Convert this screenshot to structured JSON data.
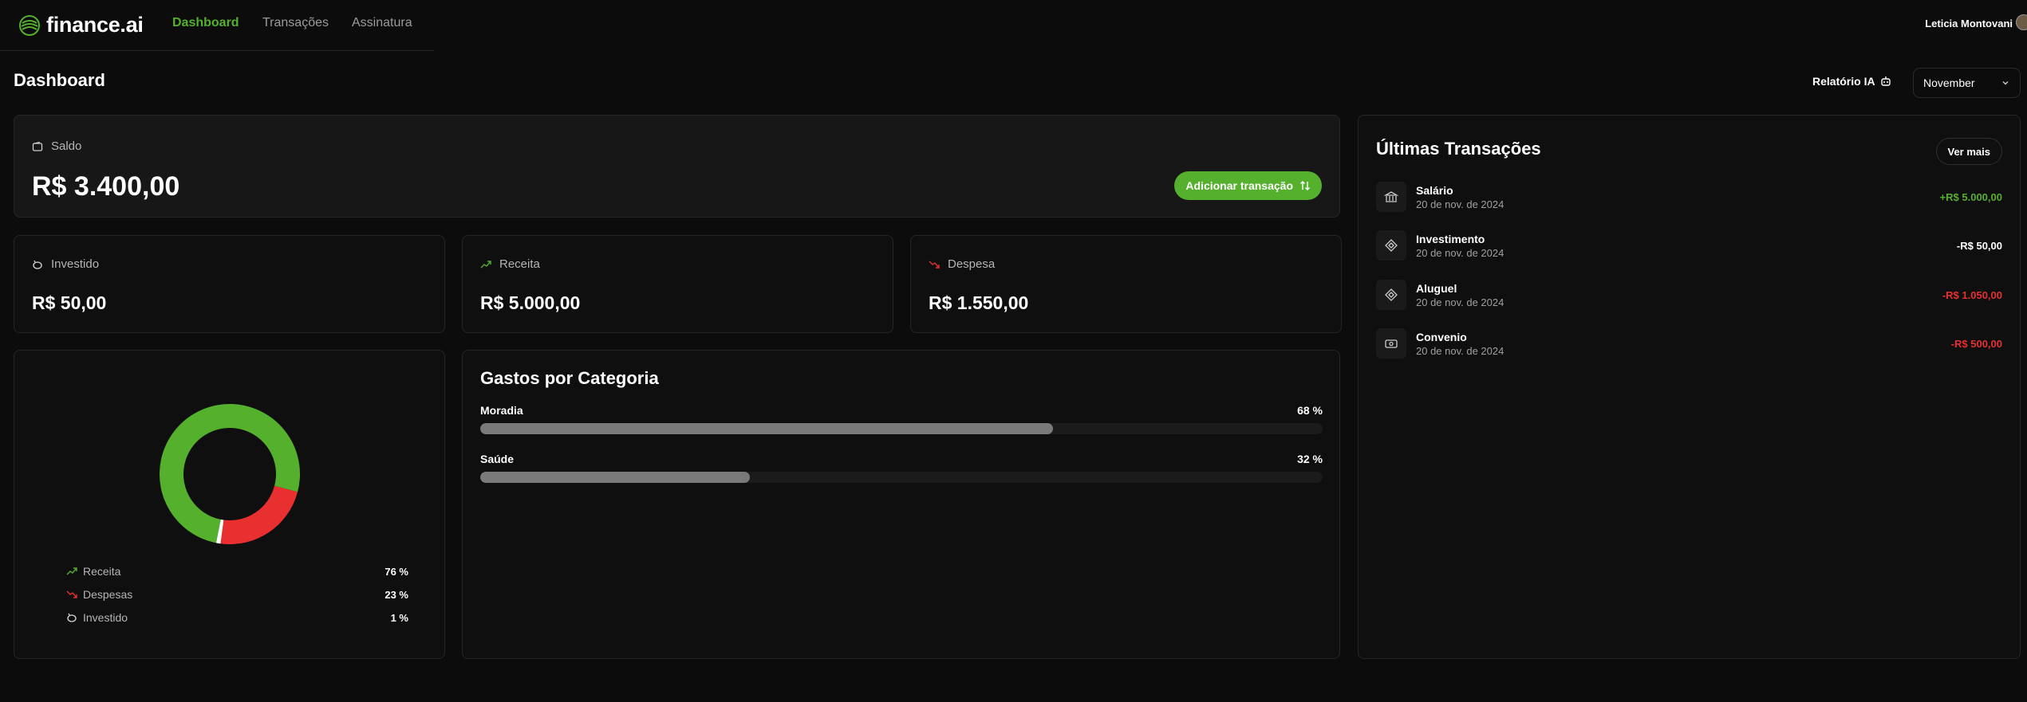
{
  "brand": {
    "name": "finance.ai"
  },
  "nav": [
    {
      "label": "Dashboard",
      "active": true
    },
    {
      "label": "Transações",
      "active": false
    },
    {
      "label": "Assinatura",
      "active": false
    }
  ],
  "user": {
    "name": "Leticia Montovani"
  },
  "page": {
    "title": "Dashboard"
  },
  "toolbar": {
    "report_label": "Relatório IA",
    "month": "November"
  },
  "saldo": {
    "label": "Saldo",
    "value": "R$ 3.400,00",
    "add_label": "Adicionar transação"
  },
  "summary": [
    {
      "label": "Investido",
      "value": "R$ 50,00",
      "icon": "piggy-bank-icon"
    },
    {
      "label": "Receita",
      "value": "R$ 5.000,00",
      "icon": "trending-up-icon"
    },
    {
      "label": "Despesa",
      "value": "R$ 1.550,00",
      "icon": "trending-down-icon"
    }
  ],
  "chart_data": {
    "type": "pie",
    "donut": true,
    "categories": [
      "Receita",
      "Despesas",
      "Investido"
    ],
    "values": [
      76,
      23,
      1
    ],
    "colors": [
      "#55b02e",
      "#e93030",
      "#ffffff"
    ],
    "labels": [
      "76 %",
      "23 %",
      "1 %"
    ]
  },
  "categories": {
    "title": "Gastos por Categoria",
    "items": [
      {
        "name": "Moradia",
        "percent": 68,
        "label": "68 %"
      },
      {
        "name": "Saúde",
        "percent": 32,
        "label": "32 %"
      }
    ]
  },
  "transactions": {
    "title": "Últimas Transações",
    "more_label": "Ver mais",
    "items": [
      {
        "name": "Salário",
        "date": "20 de nov. de 2024",
        "amount": "+R$ 5.000,00",
        "color": "#55b02e",
        "icon": "bank-icon"
      },
      {
        "name": "Investimento",
        "date": "20 de nov. de 2024",
        "amount": "-R$ 50,00",
        "color": "#ffffff",
        "icon": "pix-icon"
      },
      {
        "name": "Aluguel",
        "date": "20 de nov. de 2024",
        "amount": "-R$ 1.050,00",
        "color": "#e93030",
        "icon": "pix-icon"
      },
      {
        "name": "Convenio",
        "date": "20 de nov. de 2024",
        "amount": "-R$ 500,00",
        "color": "#e93030",
        "icon": "cash-icon"
      }
    ]
  },
  "colors": {
    "accent": "#55b02e",
    "danger": "#e93030",
    "background": "#0c0c0c"
  }
}
